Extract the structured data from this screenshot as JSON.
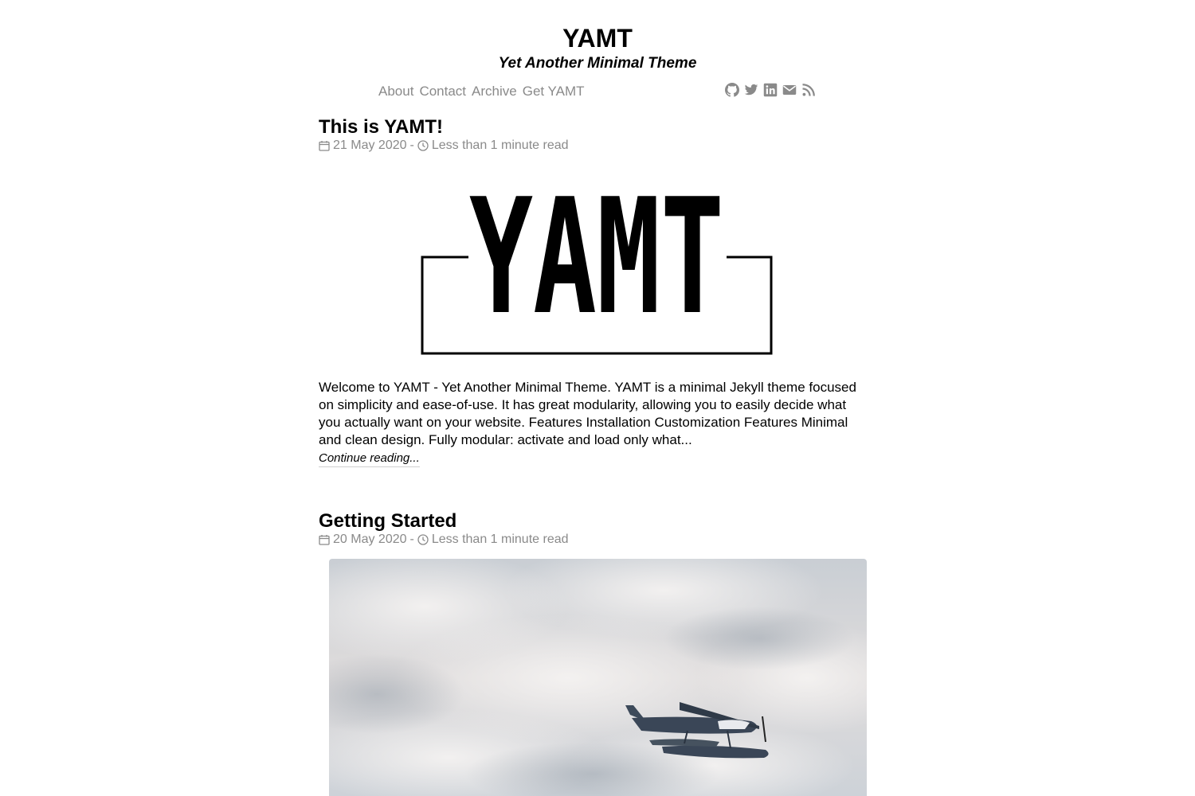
{
  "site": {
    "title": "YAMT",
    "subtitle": "Yet Another Minimal Theme"
  },
  "nav": {
    "items": [
      {
        "label": "About"
      },
      {
        "label": "Contact"
      },
      {
        "label": "Archive"
      },
      {
        "label": "Get YAMT"
      }
    ]
  },
  "social": {
    "icons": [
      "github-icon",
      "twitter-icon",
      "linkedin-icon",
      "email-icon",
      "rss-icon"
    ]
  },
  "posts": [
    {
      "title": "This is YAMT!",
      "date": "21 May 2020",
      "separator": "-",
      "read_time": "Less than 1 minute read",
      "image": {
        "logo_text": "YAMT"
      },
      "excerpt": "Welcome to YAMT - Yet Another Minimal Theme. YAMT is a minimal Jekyll theme focused on simplicity and ease-of-use. It has great modularity, allowing you to easily decide what you actually want on your website. Features Installation Customization Features Minimal and clean design. Fully modular: activate and load only what...",
      "continue_label": "Continue reading..."
    },
    {
      "title": "Getting Started",
      "date": "20 May 2020",
      "separator": "-",
      "read_time": "Less than 1 minute read"
    }
  ],
  "colors": {
    "text": "#000000",
    "muted": "#8a8a8a",
    "background": "#ffffff"
  }
}
